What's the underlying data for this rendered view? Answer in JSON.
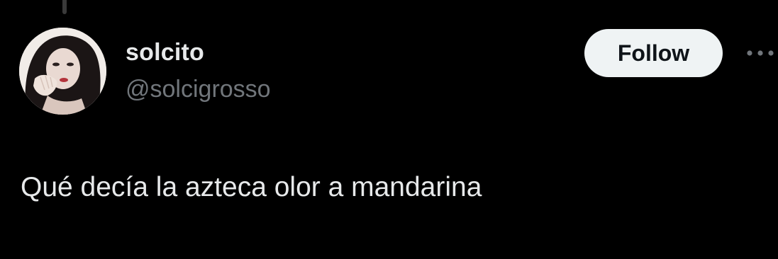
{
  "tweet": {
    "author": {
      "display_name": "solcito",
      "handle": "@solcigrosso",
      "avatar_icon": "profile-photo"
    },
    "follow_label": "Follow",
    "more_icon": "more-horizontal-icon",
    "text": "Qué decía la azteca olor a mandarina"
  },
  "colors": {
    "background": "#000000",
    "primary_text": "#e7e9ea",
    "secondary_text": "#71767b",
    "follow_bg": "#eff3f4",
    "follow_text": "#0f1419"
  }
}
